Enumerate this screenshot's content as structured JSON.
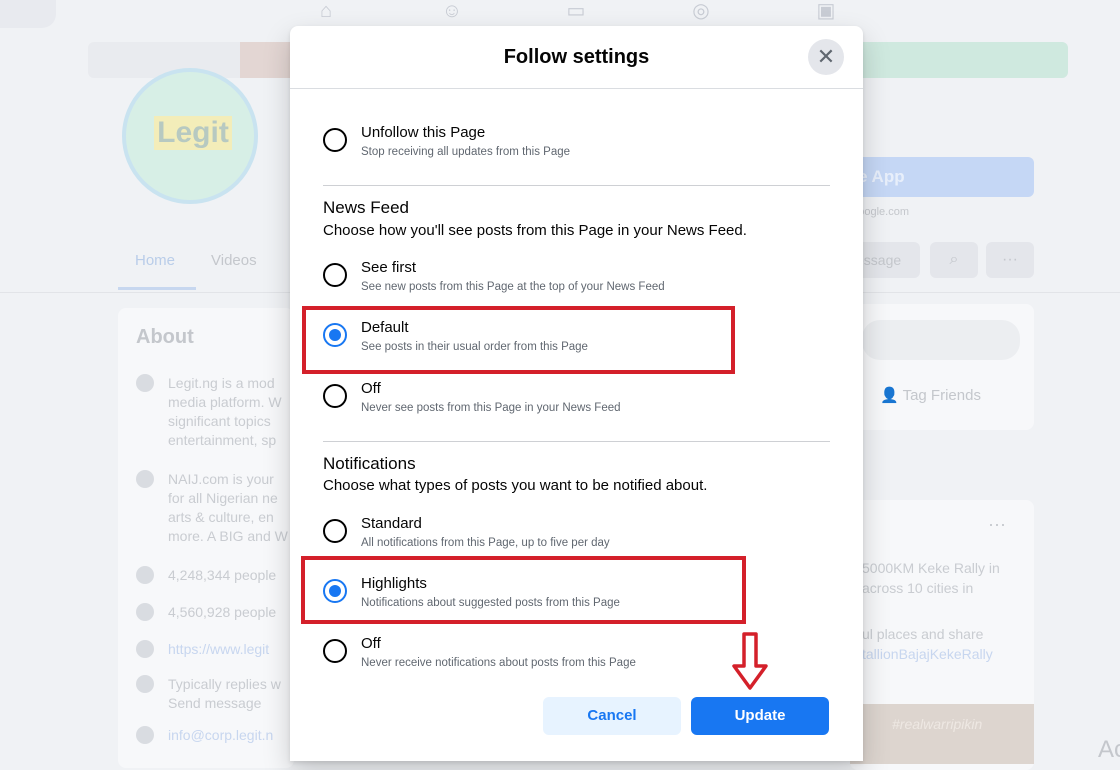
{
  "background": {
    "logo_text": "Legit",
    "use_app_label": "e App",
    "sub_url": "ggoogle.com",
    "tabs": [
      "Home",
      "Videos"
    ],
    "message_label": "essage",
    "about_title": "About",
    "about_rows": [
      "Legit.ng is a mod media platform. W significant topics entertainment, sp",
      "NAIJ.com is your for all Nigerian ne arts & culture, en more. A BIG and W",
      "4,248,344 people",
      "4,560,928 people",
      "https://www.legit",
      "Typically replies w Send message",
      "info@corp.legit.n"
    ],
    "tag_friends": "Tag Friends",
    "right_texts": [
      "5000KM Keke Rally in across 10 cities in",
      "ul places and share",
      "tallionBajajKekeRally"
    ],
    "right_image_text": "#realwarripikin",
    "edge_text": "Ac"
  },
  "modal": {
    "title": "Follow settings",
    "unfollow": {
      "label": "Unfollow this Page",
      "desc": "Stop receiving all updates from this Page"
    },
    "news_feed": {
      "title": "News Feed",
      "subtitle": "Choose how you'll see posts from this Page in your News Feed.",
      "options": [
        {
          "label": "See first",
          "desc": "See new posts from this Page at the top of your News Feed",
          "selected": false
        },
        {
          "label": "Default",
          "desc": "See posts in their usual order from this Page",
          "selected": true
        },
        {
          "label": "Off",
          "desc": "Never see posts from this Page in your News Feed",
          "selected": false
        }
      ]
    },
    "notifications": {
      "title": "Notifications",
      "subtitle": "Choose what types of posts you want to be notified about.",
      "options": [
        {
          "label": "Standard",
          "desc": "All notifications from this Page, up to five per day",
          "selected": false
        },
        {
          "label": "Highlights",
          "desc": "Notifications about suggested posts from this Page",
          "selected": true
        },
        {
          "label": "Off",
          "desc": "Never receive notifications about posts from this Page",
          "selected": false
        }
      ]
    },
    "cancel_label": "Cancel",
    "update_label": "Update"
  },
  "colors": {
    "accent": "#1877f2",
    "highlight_box": "#d4202a",
    "accent_light": "#e7f3ff"
  },
  "icons": [
    "home-icon",
    "friends-icon",
    "watch-icon",
    "groups-icon",
    "gaming-icon",
    "close-icon",
    "search-icon",
    "more-icon",
    "info-icon",
    "like-icon",
    "link-icon",
    "message-icon",
    "email-icon",
    "tag-person-icon",
    "down-arrow-icon"
  ]
}
